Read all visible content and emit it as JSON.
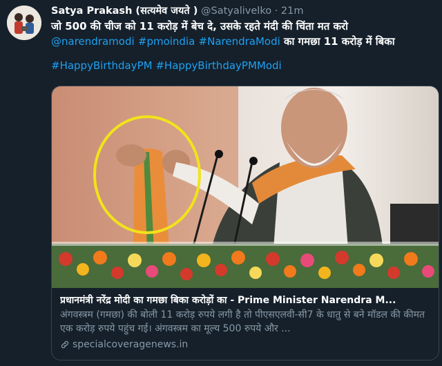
{
  "tweet": {
    "author_name": "Satya Prakash (सत्यमेव जयते )",
    "author_handle": "@Satyalivelko",
    "separator": "·",
    "time": "21m",
    "text_line1": "जो 500 की चीज को 11 करोड़ में बेच दे, उसके रहते मंदी की चिंता मत करो",
    "mentions": [
      "@narendramodi",
      "#pmoindia",
      "#NarendraModi"
    ],
    "text_line2_tail": "का गमछा 11 करोड़ में बिका",
    "hashtags": [
      "#HappyBirthdayPM",
      "#HappyBirthdayPMModi"
    ]
  },
  "card": {
    "title": "प्रधानमंत्री नरेंद्र मोदी का गमछा बिका करोड़ों का - Prime Minister Narendra M...",
    "description": "अंगवस्त्रम (गमछा) की बोली 11 करोड़ रुपये लगी है तो पीएसएलवी-सी7 के धातु से बने मॉडल की कीमत एक करोड़ रुपये पहुंच गई। अंगवस्त्रम का मूल्य 500 रुपये और ...",
    "domain": "specialcoveragenews.in"
  },
  "colors": {
    "background": "#15202b",
    "link": "#1da1f2",
    "muted": "#8899a6",
    "highlight_circle": "#f2e31a"
  },
  "icons": {
    "link": "link-icon"
  }
}
